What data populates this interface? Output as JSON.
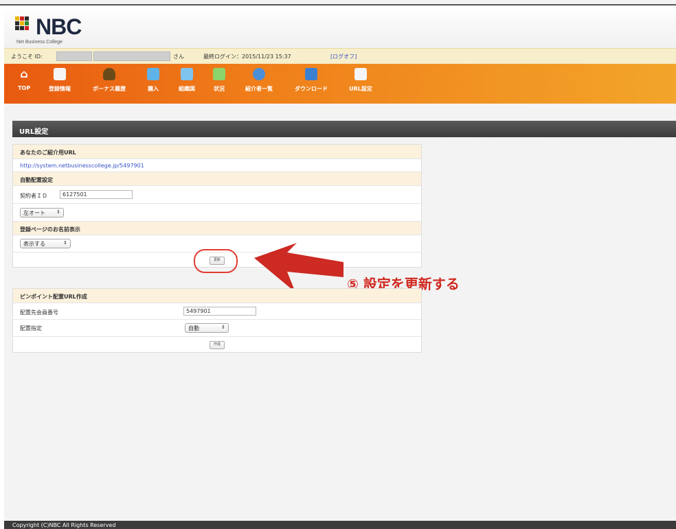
{
  "logo": {
    "title": "NBC",
    "subtitle": "Net Business College"
  },
  "welcome": {
    "prefix": "ようこそ ID:",
    "suffix": "さん",
    "last_login": "最終ログイン：2015/11/23 15:37",
    "logout": "[ログオフ]"
  },
  "nav": [
    {
      "label": "TOP",
      "icon": "home-icon",
      "color": "#ffffff"
    },
    {
      "label": "登録情報",
      "icon": "book-icon",
      "color": "#ffffff"
    },
    {
      "label": "ボーナス履歴",
      "icon": "money-bag-icon",
      "color": "#f5e0a0"
    },
    {
      "label": "購入",
      "icon": "folder-icon",
      "color": "#5fb3e8"
    },
    {
      "label": "組織図",
      "icon": "org-chart-icon",
      "color": "#7ec4ef"
    },
    {
      "label": "状況",
      "icon": "chart-icon",
      "color": "#8bd46b"
    },
    {
      "label": "紹介者一覧",
      "icon": "users-icon",
      "color": "#4a8fd8"
    },
    {
      "label": "ダウンロード",
      "icon": "download-icon",
      "color": "#3b7fd1"
    },
    {
      "label": "URL設定",
      "icon": "document-icon",
      "color": "#ffffff"
    }
  ],
  "page_title": "URL設定",
  "section1": {
    "url_header": "あなたのご紹介用URL",
    "url": "http://system.netbusinesscollege.jp/5497901",
    "auto_header": "自動配置設定",
    "contract_label": "契約者ＩＤ",
    "contract_value": "6127501",
    "position_select": "左オート",
    "name_header": "登録ページのお名前表示",
    "name_select": "表示する",
    "update_button": "更新"
  },
  "annotation": "⑤ 設定を更新する",
  "section2": {
    "header": "ピンポイント配置URL作成",
    "member_label": "配置先会員番号",
    "member_value": "5497901",
    "place_label": "配置指定",
    "place_select": "自動",
    "create_button": "作成"
  },
  "footer": "Copyright (C)NBC All Rights Reserved"
}
